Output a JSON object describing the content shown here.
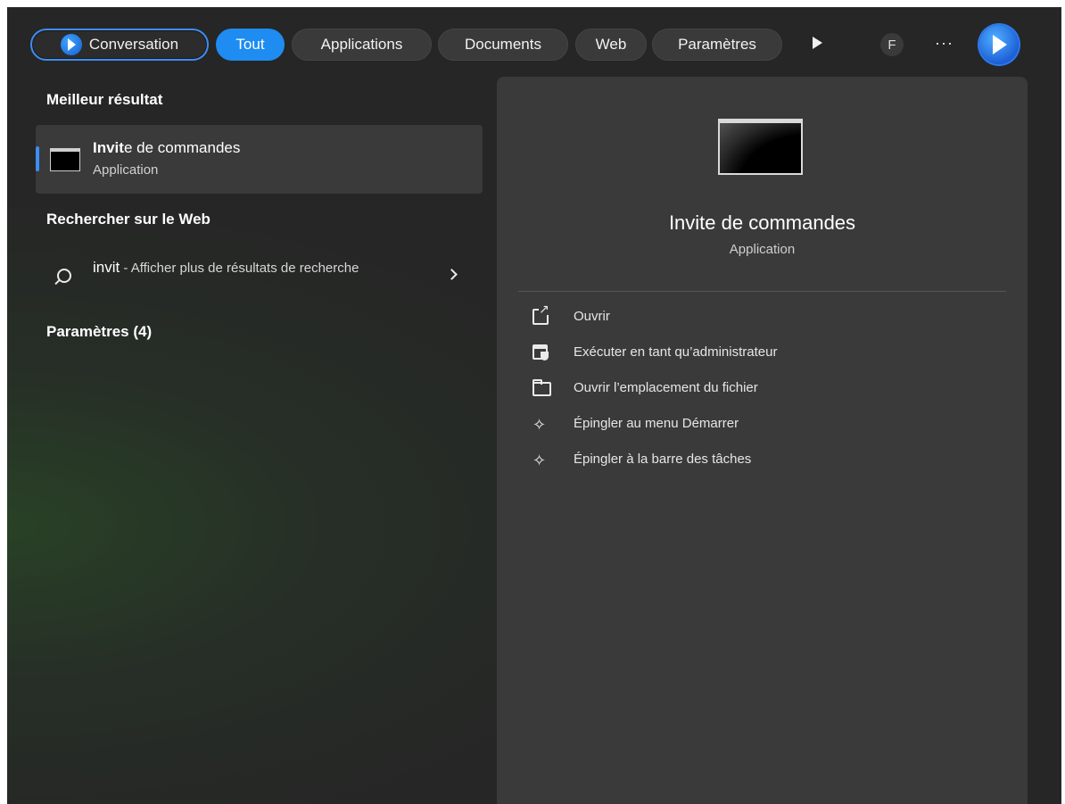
{
  "topbar": {
    "conversation": "Conversation",
    "filters": [
      "Tout",
      "Applications",
      "Documents",
      "Web",
      "Paramètres"
    ],
    "active_filter": "Tout",
    "avatar_letter": "F",
    "more": "···",
    "accent_color": "#1e8cf0"
  },
  "left": {
    "best_result_title": "Meilleur résultat",
    "best_result": {
      "name_bold": "Invit",
      "name_rest": "e de commandes",
      "type": "Application"
    },
    "web_title": "Rechercher sur le Web",
    "web_item": {
      "query": "invit",
      "text": " - Afficher plus de résultats de recherche"
    },
    "settings_title": "Paramètres (4)"
  },
  "panel": {
    "title": "Invite de commandes",
    "subtitle": "Application",
    "actions": [
      {
        "label": "Ouvrir",
        "icon": "open-external-icon"
      },
      {
        "label": "Exécuter en tant qu’administrateur",
        "icon": "run-as-admin-icon"
      },
      {
        "label": "Ouvrir l’emplacement du fichier",
        "icon": "folder-icon"
      },
      {
        "label": "Épingler au menu Démarrer",
        "icon": "pin-icon"
      },
      {
        "label": "Épingler à la barre des tâches",
        "icon": "pin-icon"
      }
    ]
  }
}
